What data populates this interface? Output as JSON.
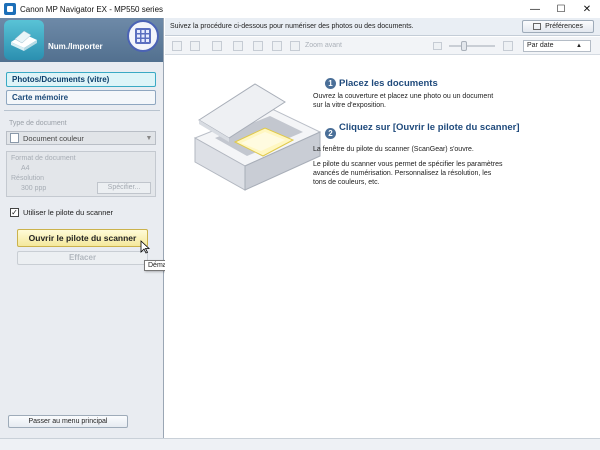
{
  "window": {
    "title": "Canon MP Navigator EX - MP550 series",
    "controls": {
      "minimize": "—",
      "maximize": "☐",
      "close": "✕"
    }
  },
  "sidebar": {
    "banner_label": "Num./Importer",
    "nav": [
      {
        "label": "Photos/Documents (vitre)",
        "active": true
      },
      {
        "label": "Carte mémoire",
        "active": false
      }
    ],
    "doc_type_label": "Type de document",
    "doc_type_value": "Document couleur",
    "doc_format_label": "Format de document",
    "doc_format_value": "A4",
    "resolution_label": "Résolution",
    "resolution_value": "300 ppp",
    "specify_label": "Spécifier...",
    "use_driver_label": "Utiliser le pilote du scanner",
    "use_driver_checked": true,
    "open_driver_label": "Ouvrir le pilote du scanner",
    "clear_label": "Effacer",
    "tooltip": "Démarrer le pilote du scanner.",
    "main_menu_label": "Passer au menu principal"
  },
  "main": {
    "info_text": "Suivez la procédure ci-dessous pour numériser des photos ou des documents.",
    "preferences_label": "Préférences",
    "zoom_label": "Zoom avant",
    "sort_label": "Par date",
    "steps": [
      {
        "num": "1",
        "title": "Placez les documents",
        "desc": "Ouvrez la couverture et placez une photo ou un document sur la vitre d'exposition."
      },
      {
        "num": "2",
        "title": "Cliquez sur [Ouvrir le pilote du scanner]",
        "desc": "La fenêtre du pilote du scanner (ScanGear) s'ouvre.",
        "desc2": "Le pilote du scanner vous permet de spécifier les paramètres avancés de numérisation. Personnalisez la résolution, les tons de couleurs, etc."
      }
    ]
  },
  "colors": {
    "accent_blue": "#1f4a7c",
    "active_nav": "#3aa9c4",
    "open_button": "#f4e89c"
  }
}
